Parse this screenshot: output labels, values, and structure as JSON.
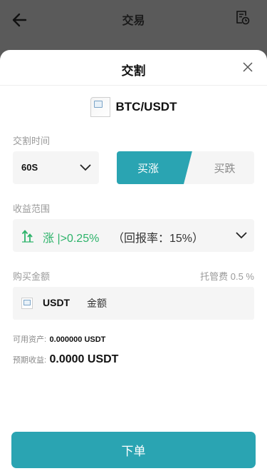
{
  "topbar": {
    "title": "交易",
    "back_icon": "arrow-left-icon",
    "history_icon": "order-history-icon"
  },
  "sheet": {
    "title": "交割",
    "close_icon": "close-icon"
  },
  "pair": {
    "name": "BTC/USDT"
  },
  "time": {
    "label": "交割时间",
    "value": "60S"
  },
  "direction": {
    "buy_up": "买涨",
    "buy_down": "买跌",
    "selected": "买涨"
  },
  "range": {
    "label": "收益范围",
    "rise": "涨 |>0.25%",
    "return": "（回报率：15%）"
  },
  "amount": {
    "label": "购买金额",
    "fee": "托管费 0.5 %",
    "coin": "USDT",
    "placeholder": "金额"
  },
  "available": {
    "label": "可用资产:",
    "value": "0.000000 USDT"
  },
  "expected": {
    "label": "预期收益:",
    "value": "0.0000 USDT"
  },
  "submit": {
    "label": "下单"
  },
  "colors": {
    "accent": "#2aa4b2",
    "rise": "#2db36a",
    "overlay": "#5a5a5a"
  }
}
